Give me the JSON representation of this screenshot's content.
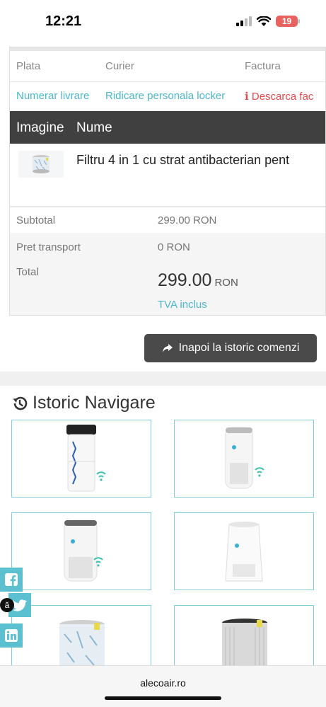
{
  "status": {
    "time": "12:21",
    "battery": "19"
  },
  "order": {
    "headers": [
      "Plata",
      "Curier",
      "Factura"
    ],
    "values": [
      "Numerar livrare",
      "Ridicare personala locker",
      "Descarca fac"
    ],
    "product_table": {
      "col_image": "Imagine",
      "col_name": "Nume",
      "product_name": "Filtru 4 in 1 cu strat antibacterian pent"
    },
    "totals": {
      "subtotal_label": "Subtotal",
      "subtotal_value": "299.00 RON",
      "transport_label": "Pret transport",
      "transport_value": "0 RON",
      "total_label": "Total",
      "total_amount": "299.00",
      "total_currency": "RON",
      "vat_note": "TVA inclus"
    },
    "back_button": "Inapoi la istoric comenzi"
  },
  "history": {
    "title": "Istoric Navigare"
  },
  "social": {
    "bubble": "ă"
  },
  "browser": {
    "url": "alecoair.ro"
  },
  "colors": {
    "accent": "#4bb6cc",
    "dark": "#404040",
    "danger": "#e24b4b",
    "card_border": "#7fd0de"
  }
}
